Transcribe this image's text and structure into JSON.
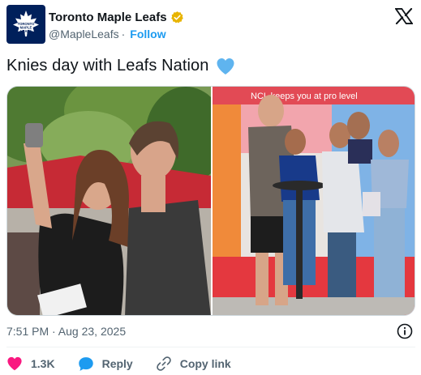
{
  "author": {
    "display_name": "Toronto Maple Leafs",
    "handle": "@MapleLeafs",
    "separator": "·",
    "follow_label": "Follow",
    "avatar_text": "TORONTO MAPLE LEAFS",
    "brand_color": "#00205b",
    "verified_color": "#e8b400"
  },
  "tweet": {
    "text": "Knies day with Leafs Nation",
    "emoji": "blue-heart-icon"
  },
  "media": {
    "left_photo": "selfie-with-fan",
    "right_photo": "group-photo-with-family",
    "banner_text": "NCL keeps you at pro level"
  },
  "meta": {
    "timestamp": "7:51 PM · Aug 23, 2025"
  },
  "actions": {
    "like_count": "1.3K",
    "reply_label": "Reply",
    "copy_label": "Copy link",
    "like_color": "#f91880",
    "reply_color": "#1d9bf0"
  }
}
